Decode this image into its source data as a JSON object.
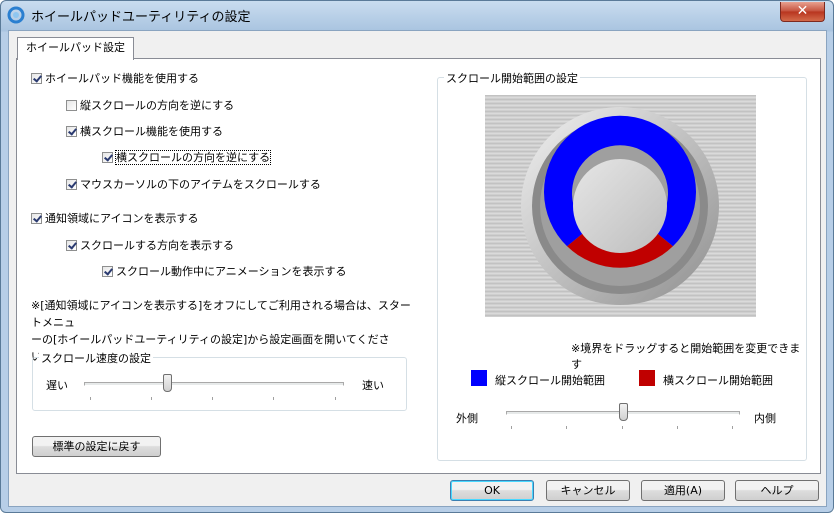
{
  "window": {
    "title": "ホイールパッドユーティリティの設定",
    "close_label": "✕"
  },
  "tabs": [
    {
      "label": "ホイールパッド設定"
    }
  ],
  "options": [
    {
      "label": "ホイールパッド機能を使用する",
      "checked": true
    },
    {
      "label": "縦スクロールの方向を逆にする",
      "checked": false
    },
    {
      "label": "横スクロール機能を使用する",
      "checked": true
    },
    {
      "label": "横スクロールの方向を逆にする",
      "checked": true
    },
    {
      "label": "マウスカーソルの下のアイテムをスクロールする",
      "checked": true
    },
    {
      "label": "通知領域にアイコンを表示する",
      "checked": true
    },
    {
      "label": "スクロールする方向を表示する",
      "checked": true
    },
    {
      "label": "スクロール動作中にアニメーションを表示する",
      "checked": true
    }
  ],
  "note": {
    "line1": "※[通知領域にアイコンを表示する]をオフにしてご利用される場合は、スタートメニュ",
    "line2": "ーの[ホイールパッドユーティリティの設定]から設定画面を開いてください。"
  },
  "speed": {
    "title": "スクロール速度の設定",
    "min_label": "遅い",
    "max_label": "速い",
    "value_fraction": 0.32
  },
  "reset_button": "標準の設定に戻す",
  "scroll_area": {
    "title": "スクロール開始範囲の設定",
    "hint": "※境界をドラッグすると開始範囲を変更できます",
    "vertical_legend": "縦スクロール開始範囲",
    "horizontal_legend": "横スクロール開始範囲",
    "vertical_color": "#0000ff",
    "horizontal_color": "#c00000",
    "slider_left_label": "外側",
    "slider_right_label": "内側",
    "slider_fraction": 0.5
  },
  "buttons": {
    "ok": "OK",
    "cancel": "キャンセル",
    "apply": "適用(A)",
    "help": "ヘルプ"
  }
}
